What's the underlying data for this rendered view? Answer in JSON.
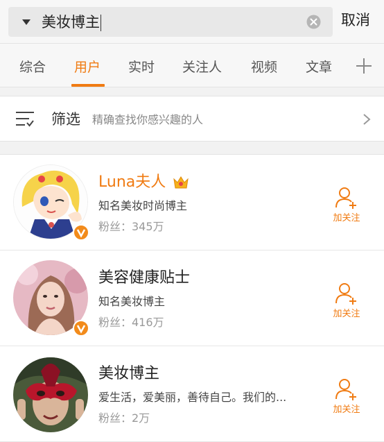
{
  "search": {
    "query": "美妆博主",
    "cancel_label": "取消"
  },
  "tabs": [
    {
      "label": "综合",
      "active": false
    },
    {
      "label": "用户",
      "active": true
    },
    {
      "label": "实时",
      "active": false
    },
    {
      "label": "关注人",
      "active": false
    },
    {
      "label": "视频",
      "active": false
    },
    {
      "label": "文章",
      "active": false
    }
  ],
  "filter": {
    "label": "筛选",
    "hint": "精确查找你感兴趣的人"
  },
  "users": [
    {
      "name": "Luna夫人",
      "description": "知名美妆时尚博主",
      "fans": "粉丝：345万",
      "verified": true,
      "member_crown": true,
      "follow_label": "加关注",
      "avatar": "anime-sailor-girl"
    },
    {
      "name": "美容健康贴士",
      "description": "知名美妆博主",
      "fans": "粉丝：416万",
      "verified": true,
      "member_crown": false,
      "follow_label": "加关注",
      "avatar": "woman-portrait"
    },
    {
      "name": "美妆博主",
      "description": "爱生活，爱美丽，善待自己。我们的...",
      "fans": "粉丝：2万",
      "verified": false,
      "member_crown": false,
      "follow_label": "加关注",
      "avatar": "masquerade-mask-person"
    }
  ],
  "colors": {
    "accent": "#f07b12",
    "verified_badge": "#f28b1b",
    "background": "#f2f2f2"
  }
}
